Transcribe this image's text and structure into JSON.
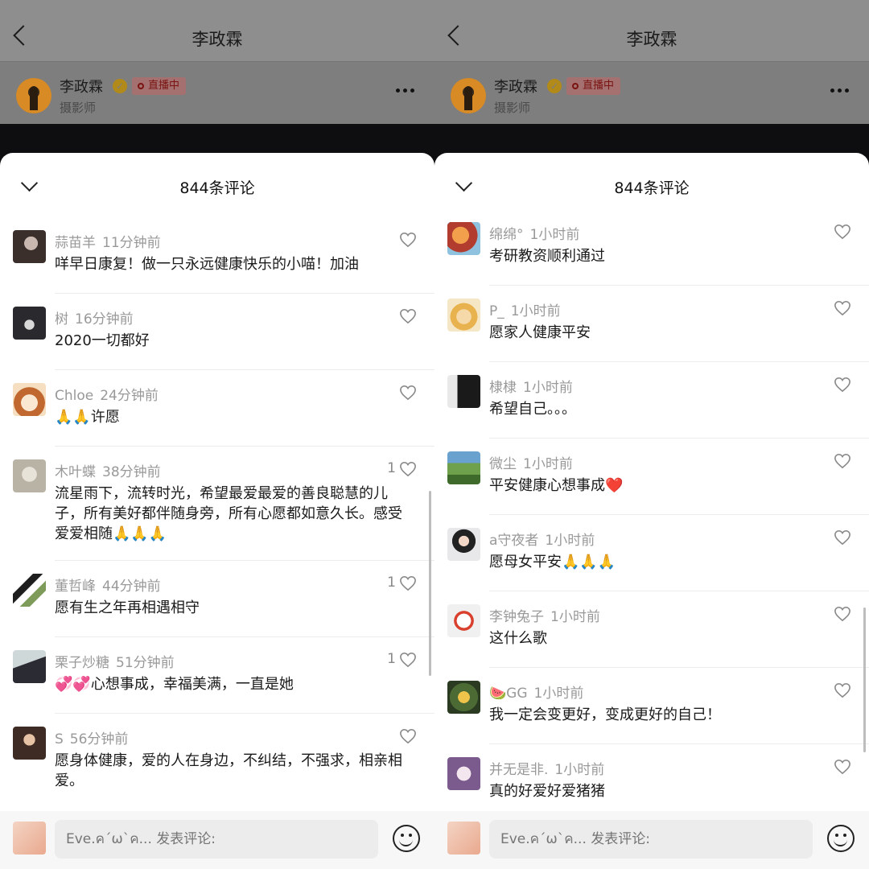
{
  "header": {
    "title": "李政霖",
    "user_name": "李政霖",
    "verified_mark": "✓",
    "live_label": "直播中",
    "user_title": "摄影师"
  },
  "sheet": {
    "title": "844条评论"
  },
  "colors": {
    "heart": "#c7c7c7",
    "live": "#7a1412"
  },
  "left_comments": [
    {
      "name": "蒜苗羊",
      "time": "11分钟前",
      "text": "咩早日康复！做一只永远健康快乐的小喵！加油",
      "likes": ""
    },
    {
      "name": "树",
      "time": "16分钟前",
      "text": "2020一切都好",
      "likes": ""
    },
    {
      "name": "Chloe",
      "time": "24分钟前",
      "text": "🙏🙏许愿",
      "likes": ""
    },
    {
      "name": "木叶蝶",
      "time": "38分钟前",
      "text": "流星雨下，流转时光，希望最爱最爱的善良聪慧的儿子，所有美好都伴随身旁，所有心愿都如意久长。感受爱爱相随🙏🙏🙏",
      "likes": "1"
    },
    {
      "name": "董哲峰",
      "time": "44分钟前",
      "text": "愿有生之年再相遇相守",
      "likes": "1"
    },
    {
      "name": "栗子炒糖",
      "time": "51分钟前",
      "text": "💞💞心想事成，幸福美满，一直是她",
      "likes": "1"
    },
    {
      "name": "S",
      "time": "56分钟前",
      "text": "愿身体健康，爱的人在身边，不纠结，不强求，相亲相爱。",
      "likes": ""
    }
  ],
  "right_comments": [
    {
      "name": "绵绵°",
      "time": "1小时前",
      "text": "考研教资顺利通过",
      "likes": ""
    },
    {
      "name": "P_",
      "time": "1小时前",
      "text": "愿家人健康平安",
      "likes": ""
    },
    {
      "name": "棣棣",
      "time": "1小时前",
      "text": "希望自己。。。",
      "likes": ""
    },
    {
      "name": "微尘",
      "time": "1小时前",
      "text": "平安健康心想事成❤️",
      "likes": ""
    },
    {
      "name": "a守夜者",
      "time": "1小时前",
      "text": "愿母女平安🙏🙏🙏",
      "likes": ""
    },
    {
      "name": "李钟兔子",
      "time": "1小时前",
      "text": "这什么歌",
      "likes": ""
    },
    {
      "name": "🍉GG",
      "time": "1小时前",
      "text": "我一定会变更好，变成更好的自己！",
      "likes": ""
    },
    {
      "name": "并无是非.",
      "time": "1小时前",
      "text": "真的好爱好爱猪猪",
      "likes": ""
    }
  ],
  "composer": {
    "placeholder": "Eve.ค´ω`ค... 发表评论:"
  }
}
